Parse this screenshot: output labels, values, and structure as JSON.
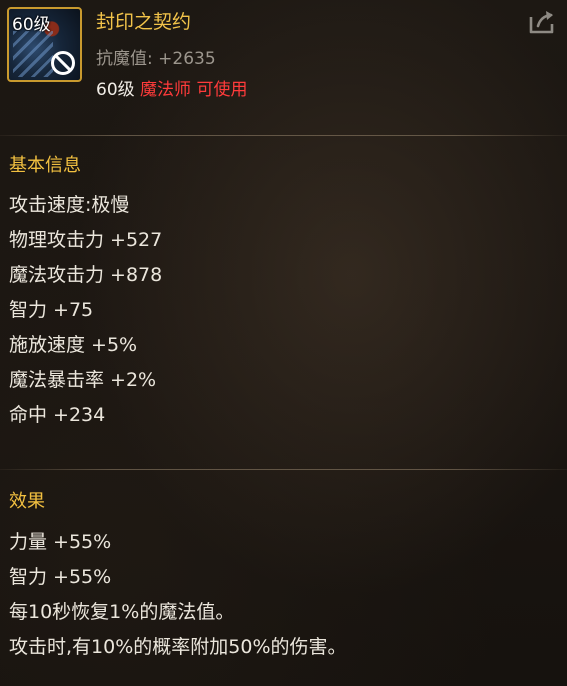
{
  "item": {
    "icon_level": "60级",
    "name": "封印之契约",
    "resist": "抗魔值: +2635",
    "req_level": "60级",
    "req_class": "魔法师 可使用"
  },
  "basic": {
    "title": "基本信息",
    "stats": [
      "攻击速度:极慢",
      "物理攻击力 +527",
      "魔法攻击力 +878",
      "智力 +75",
      "施放速度 +5%",
      "魔法暴击率 +2%",
      "命中 +234"
    ]
  },
  "effect": {
    "title": "效果",
    "lines": [
      "力量 +55%",
      "智力 +55%",
      "每10秒恢复1%的魔法值。",
      "攻击时,有10%的概率附加50%的伤害。"
    ]
  },
  "colors": {
    "title_gold": "#f3c44a",
    "class_red": "#ff3b3b",
    "icon_border": "#c99a2e"
  },
  "icons": [
    "no-use-icon",
    "share-icon"
  ]
}
